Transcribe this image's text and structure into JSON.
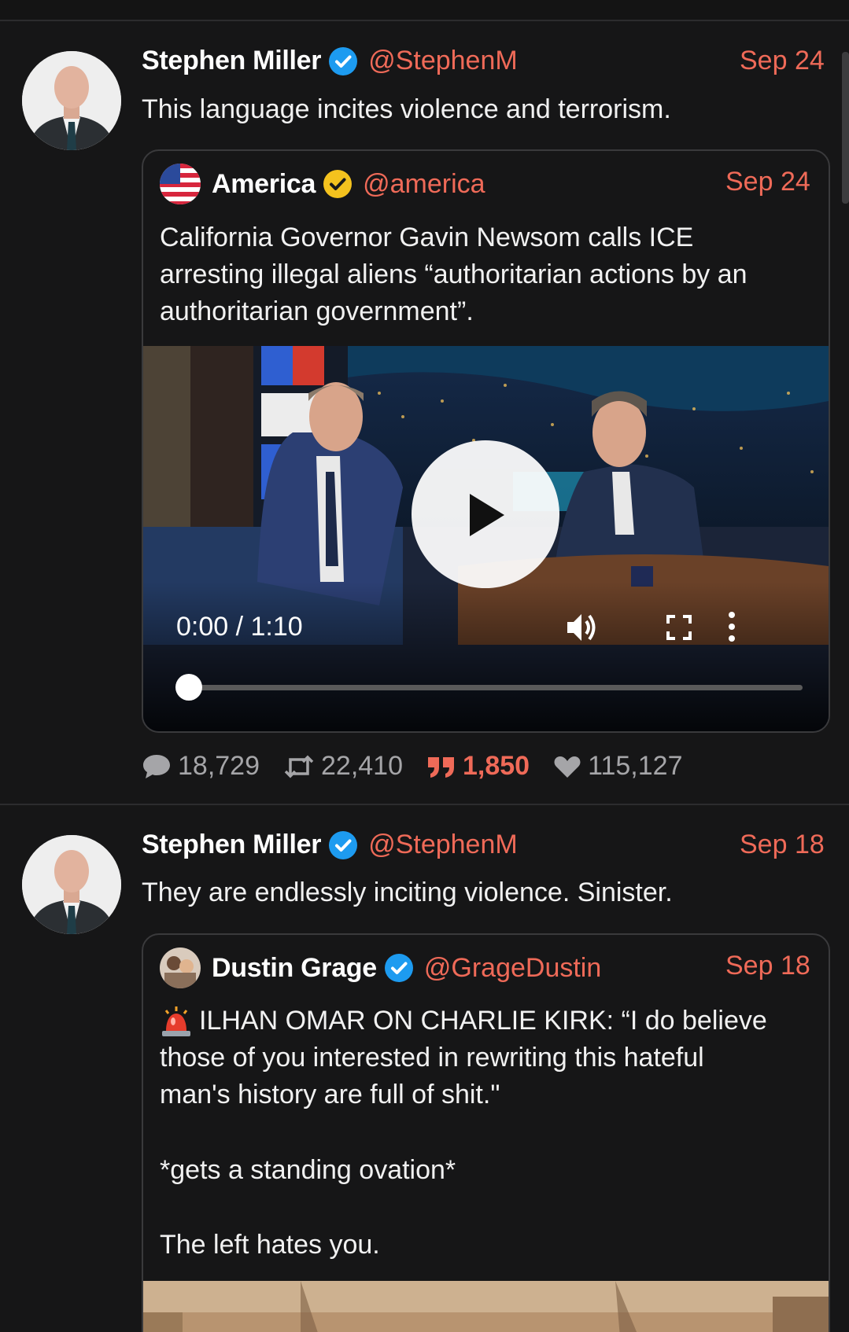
{
  "feed": [
    {
      "author": {
        "name": "Stephen Miller",
        "handle": "@StephenM",
        "verified_color": "#1d9bf0"
      },
      "date": "Sep 24",
      "text": "This language incites violence and terrorism.",
      "quote": {
        "author": {
          "name": "America",
          "handle": "@america",
          "verified_color": "#f4c21e"
        },
        "date": "Sep 24",
        "text_lines": [
          "California Governor Gavin Newsom calls ICE",
          "arresting illegal aliens “authoritarian actions by an",
          "authoritarian government”."
        ],
        "video": {
          "time": "0:00 / 1:10",
          "progress": 0
        }
      },
      "stats": {
        "replies": "18,729",
        "reposts": "22,410",
        "quotes": "1,850",
        "likes": "115,127"
      }
    },
    {
      "author": {
        "name": "Stephen Miller",
        "handle": "@StephenM",
        "verified_color": "#1d9bf0"
      },
      "date": "Sep 18",
      "text": "They are endlessly inciting violence. Sinister.",
      "quote": {
        "author": {
          "name": "Dustin Grage",
          "handle": "@GrageDustin",
          "verified_color": "#1d9bf0"
        },
        "date": "Sep 18",
        "text_lines": [
          "ILHAN OMAR ON CHARLIE KIRK: “I do believe",
          "those of you interested in rewriting this hateful",
          "man's history are full of shit.\"",
          "",
          "*gets a standing ovation*",
          "",
          "The left hates you."
        ]
      }
    }
  ],
  "colors": {
    "accent": "#ef6a58",
    "background": "#161617",
    "muted": "#a5a5a8"
  }
}
